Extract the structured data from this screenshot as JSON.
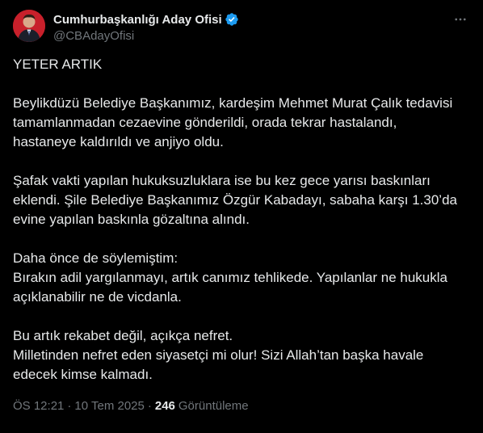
{
  "author": {
    "display_name": "Cumhurbaşkanlığı Aday Ofisi",
    "handle": "@CBAdayOfisi",
    "verified_icon": "verified-badge-icon",
    "avatar_icon": "profile-photo-avatar"
  },
  "more_icon": "more-options-icon",
  "tweet": {
    "paragraphs": [
      {
        "lines": [
          "YETER ARTIK"
        ]
      },
      {
        "lines": [
          "Beylikdüzü Belediye Başkanımız, kardeşim Mehmet Murat Çalık tedavisi",
          "tamamlanmadan cezaevine gönderildi, orada tekrar hastalandı,",
          "hastaneye kaldırıldı ve anjiyo oldu."
        ]
      },
      {
        "lines": [
          "Şafak vakti yapılan hukuksuzluklara ise bu kez gece yarısı baskınları",
          "eklendi. Şile Belediye Başkanımız Özgür Kabadayı, sabaha karşı 1.30’da",
          "evine yapılan baskınla gözaltına alındı."
        ]
      },
      {
        "lines": [
          "Daha önce de söylemiştim:",
          "Bırakın adil yargılanmayı, artık canımız tehlikede. Yapılanlar ne hukukla",
          "açıklanabilir ne de vicdanla."
        ]
      },
      {
        "lines": [
          "Bu artık rekabet değil, açıkça nefret.",
          "Milletinden nefret eden siyasetçi mi olur! Sizi Allah’tan başka havale",
          "edecek kimse kalmadı."
        ]
      }
    ]
  },
  "meta": {
    "time": "ÖS 12:21",
    "date": "10 Tem 2025",
    "separator": "·",
    "views_count": "246",
    "views_label": "Görüntüleme"
  },
  "colors": {
    "background": "#000000",
    "text_primary": "#e7e9ea",
    "text_secondary": "#71767b",
    "verified_blue": "#1d9bf0"
  }
}
